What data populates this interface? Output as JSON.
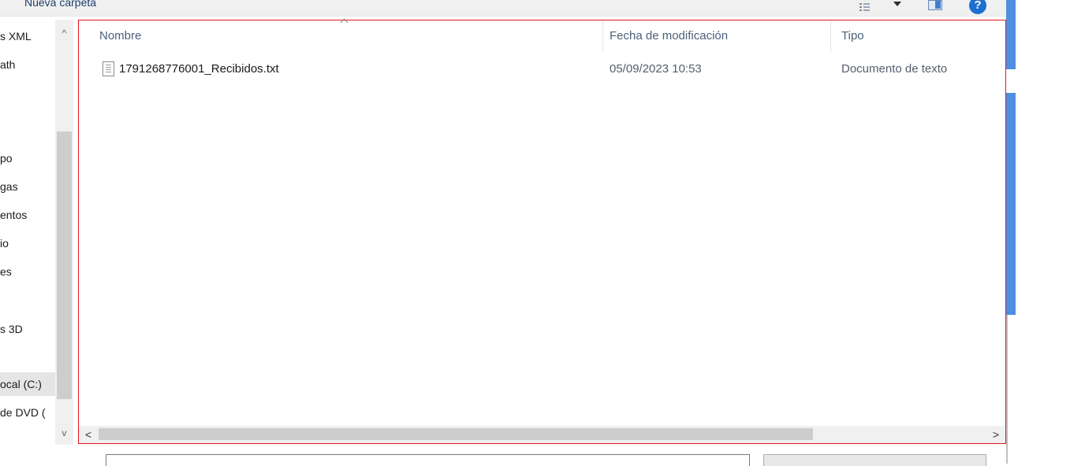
{
  "toolbar": {
    "new_folder_label": "Nueva carpeta",
    "help_glyph": "?"
  },
  "nav_pane": {
    "items": [
      {
        "label": "s XML"
      },
      {
        "label": "ath"
      },
      {
        "label": "po"
      },
      {
        "label": "gas"
      },
      {
        "label": "entos"
      },
      {
        "label": "io"
      },
      {
        "label": "es"
      },
      {
        "label": "s 3D"
      },
      {
        "label": "ocal (C:)",
        "selected": true
      },
      {
        "label": "de DVD ("
      }
    ],
    "scroll_up_glyph": "^",
    "scroll_down_glyph": "v"
  },
  "file_list": {
    "columns": {
      "name": "Nombre",
      "modified": "Fecha de modificación",
      "type": "Tipo"
    },
    "sort_column": "name",
    "rows": [
      {
        "name": "1791268776001_Recibidos.txt",
        "modified": "05/09/2023 10:53",
        "type": "Documento de texto",
        "icon": "text-file-icon"
      }
    ],
    "scroll_left_glyph": "<",
    "scroll_right_glyph": ">"
  },
  "colors": {
    "highlight_border": "#e8141b",
    "header_text": "#4c607a",
    "accent": "#1d6fd0"
  }
}
